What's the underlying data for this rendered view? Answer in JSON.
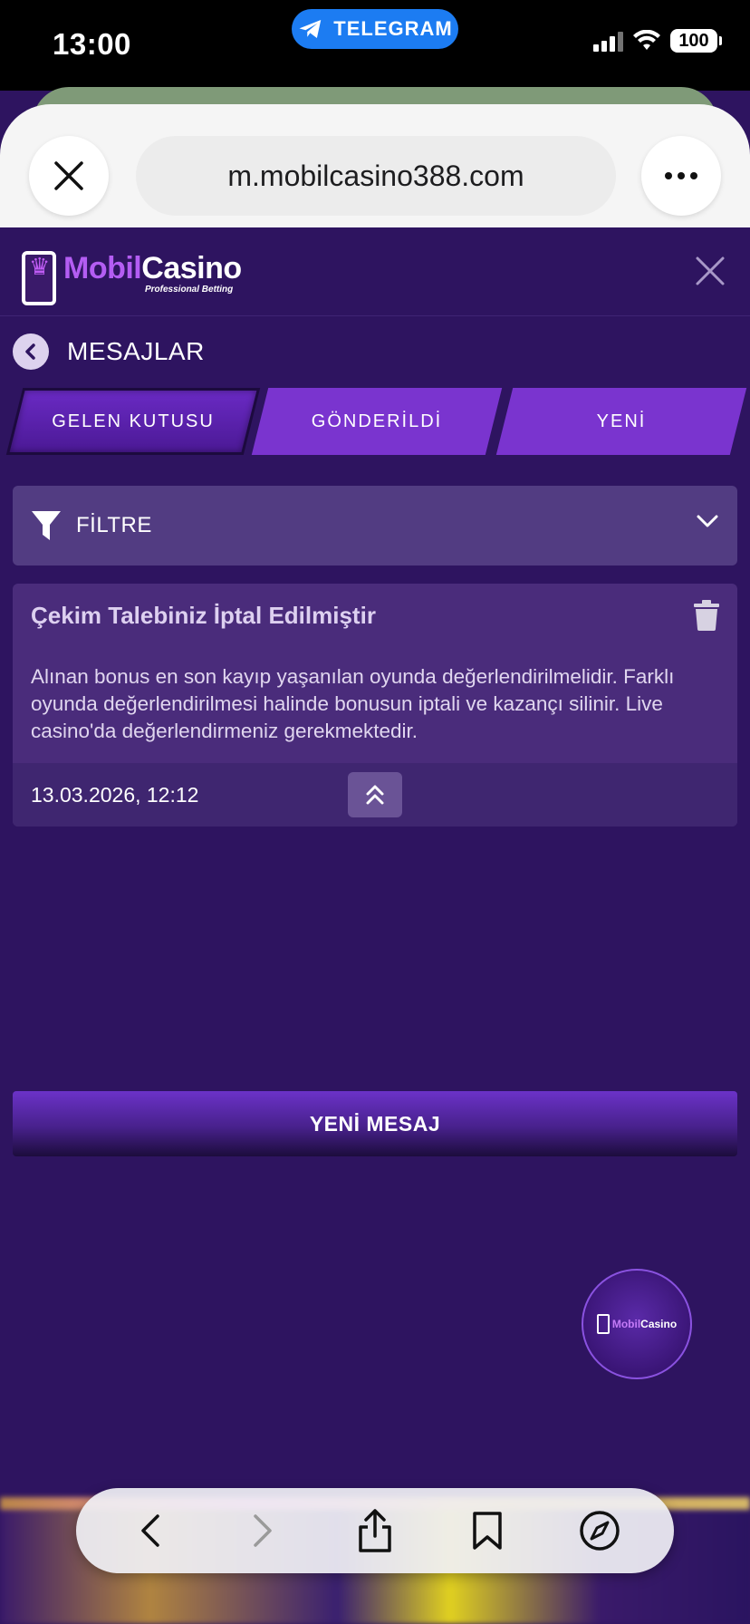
{
  "status_bar": {
    "time": "13:00",
    "pill_label": "TELEGRAM",
    "battery": "100"
  },
  "browser": {
    "url": "m.mobilcasino388.com"
  },
  "site": {
    "logo_main_1": "Mobil",
    "logo_main_2": "Casino",
    "logo_tagline": "Professional Betting"
  },
  "page": {
    "title": "MESAJLAR"
  },
  "tabs": [
    {
      "label": "GELEN KUTUSU",
      "active": true
    },
    {
      "label": "GÖNDERİLDİ",
      "active": false
    },
    {
      "label": "YENİ",
      "active": false
    }
  ],
  "filter": {
    "label": "FİLTRE"
  },
  "message": {
    "title": "Çekim Talebiniz İptal Edilmiştir",
    "body": "Alınan bonus en son kayıp yaşanılan oyunda değerlendirilmelidir. Farklı oyunda değerlendirilmesi halinde bonusun iptali ve kazançı silinir. Live casino'da değerlendirmeniz gerekmektedir.",
    "date": "13.03.2026, 12:12"
  },
  "new_message_button": "YENİ MESAJ",
  "colors": {
    "accent": "#7a34cf",
    "background": "#2e1460",
    "card": "#4a2c7b"
  },
  "icons": {
    "toolbar": [
      "back-arrow-icon",
      "forward-arrow-icon",
      "share-icon",
      "bookmarks-icon",
      "compass-icon"
    ]
  }
}
